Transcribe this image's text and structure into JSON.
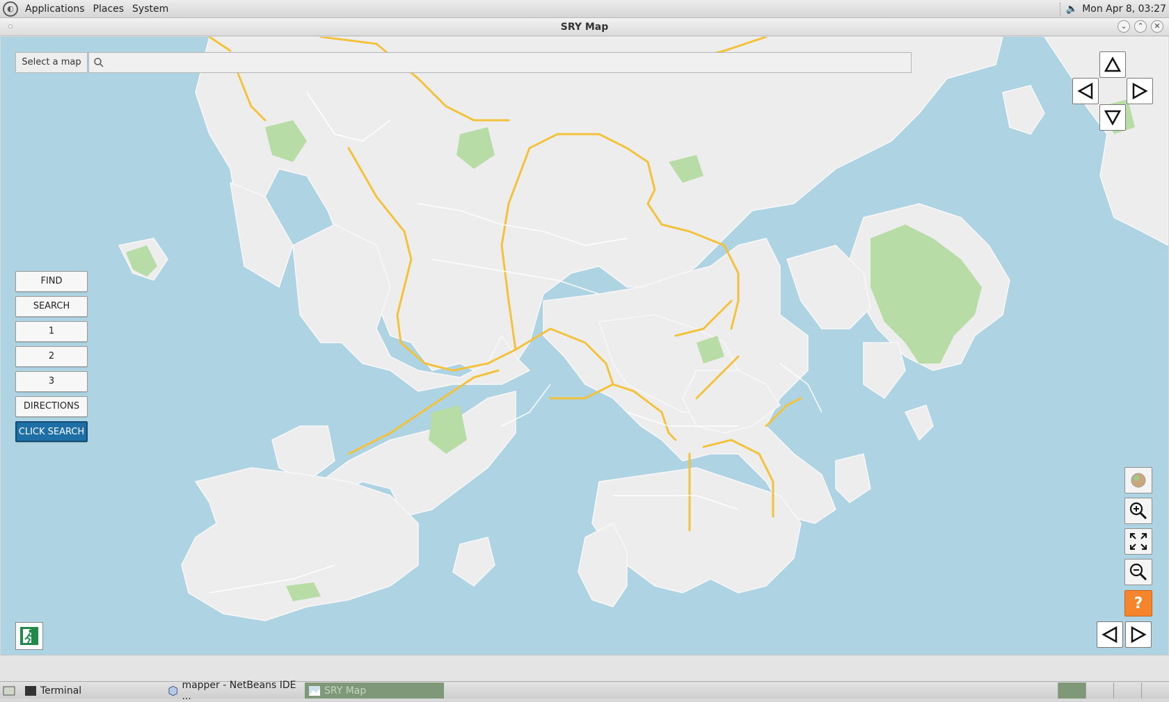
{
  "top_panel": {
    "menus": [
      "Applications",
      "Places",
      "System"
    ],
    "clock": "Mon Apr  8, 03:27"
  },
  "window": {
    "title": "SRY Map"
  },
  "search": {
    "select_map_label": "Select a map",
    "value": ""
  },
  "side_buttons": {
    "find": "FIND",
    "search": "SEARCH",
    "one": "1",
    "two": "2",
    "three": "3",
    "directions": "DIRECTIONS",
    "click_search": "CLICK SEARCH"
  },
  "help_label": "?",
  "taskbar": {
    "items": [
      "Terminal",
      "mapper - NetBeans IDE ...",
      "SRY Map"
    ]
  },
  "colors": {
    "water": "#aed3e2",
    "land": "#ededed",
    "park": "#b5dca0",
    "highway": "#f7c73a",
    "accent": "#1d6fa6",
    "help": "#f5842a"
  }
}
